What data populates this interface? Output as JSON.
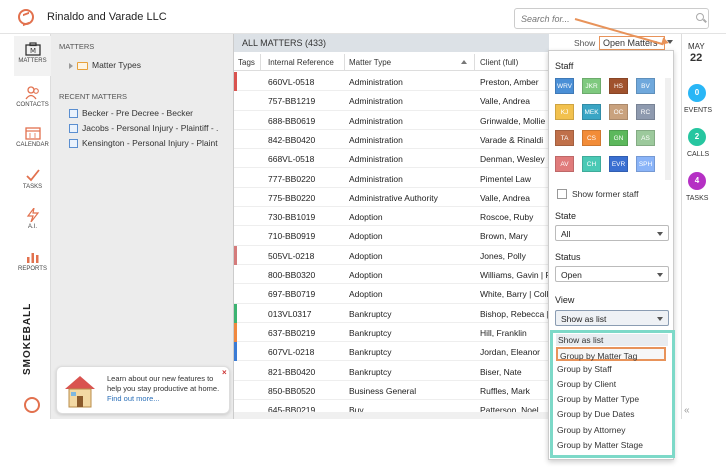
{
  "app": {
    "firm_name": "Rinaldo and Varade LLC",
    "brand": "SMOKEBALL"
  },
  "search": {
    "placeholder": "Search for..."
  },
  "nav": [
    {
      "label": "MATTERS"
    },
    {
      "label": "CONTACTS"
    },
    {
      "label": "CALENDAR"
    },
    {
      "label": "TASKS"
    },
    {
      "label": "A.I."
    },
    {
      "label": "REPORTS"
    }
  ],
  "sidepanel": {
    "heading": "MATTERS",
    "tree_item": "Matter Types",
    "recent_heading": "RECENT MATTERS",
    "recent": [
      "Becker - Pre Decree - Becker",
      "Jacobs - Personal Injury - Plaintiff - .",
      "Kensington - Personal Injury - Plaint"
    ]
  },
  "promo": {
    "text": "Learn about our new features to help you stay productive at home.",
    "link": "Find out more...",
    "close": "×"
  },
  "main": {
    "title": "ALL MATTERS (433)",
    "show_label": "Show",
    "show_value": "Open Matters",
    "columns": [
      "Tags",
      "Internal Reference",
      "Matter Type",
      "Client (full)"
    ],
    "rows": [
      {
        "tag": "#d9534f",
        "ref": "660VL-0518",
        "type": "Administration",
        "client": "Preston, Amber"
      },
      {
        "tag": "",
        "ref": "757-BB1219",
        "type": "Administration",
        "client": "Valle, Andrea"
      },
      {
        "tag": "",
        "ref": "688-BB0619",
        "type": "Administration",
        "client": "Grinwalde, Mollie"
      },
      {
        "tag": "",
        "ref": "842-BB0420",
        "type": "Administration",
        "client": "Varade & Rinaldi"
      },
      {
        "tag": "",
        "ref": "668VL-0518",
        "type": "Administration",
        "client": "Denman, Wesley"
      },
      {
        "tag": "",
        "ref": "777-BB0220",
        "type": "Administration",
        "client": "Pimentel Law"
      },
      {
        "tag": "",
        "ref": "775-BB0220",
        "type": "Administrative Authority",
        "client": "Valle, Andrea"
      },
      {
        "tag": "",
        "ref": "730-BB1019",
        "type": "Adoption",
        "client": "Roscoe, Ruby"
      },
      {
        "tag": "",
        "ref": "710-BB0919",
        "type": "Adoption",
        "client": "Brown, Mary"
      },
      {
        "tag": "#d47b7b",
        "ref": "505VL-0218",
        "type": "Adoption",
        "client": "Jones, Polly"
      },
      {
        "tag": "",
        "ref": "800-BB0320",
        "type": "Adoption",
        "client": "Williams, Gavin | P"
      },
      {
        "tag": "",
        "ref": "697-BB0719",
        "type": "Adoption",
        "client": "White, Barry | Coll"
      },
      {
        "tag": "#3cb371",
        "ref": "013VL0317",
        "type": "Bankruptcy",
        "client": "Bishop, Rebecca |"
      },
      {
        "tag": "#f0883e",
        "ref": "637-BB0219",
        "type": "Bankruptcy",
        "client": "Hill, Franklin"
      },
      {
        "tag": "#3a7bd5",
        "ref": "607VL-0218",
        "type": "Bankruptcy",
        "client": "Jordan, Eleanor"
      },
      {
        "tag": "",
        "ref": "821-BB0420",
        "type": "Bankruptcy",
        "client": "Biser, Nate"
      },
      {
        "tag": "",
        "ref": "850-BB0520",
        "type": "Business General",
        "client": "Ruffles, Mark"
      },
      {
        "tag": "",
        "ref": "645-BB0219",
        "type": "Buy",
        "client": "Patterson, Noel"
      }
    ]
  },
  "filters": {
    "staff_label": "Staff",
    "staff": [
      {
        "code": "WRV",
        "color": "#4a8fd6"
      },
      {
        "code": "JKR",
        "color": "#7fc97f"
      },
      {
        "code": "HS",
        "color": "#a0522d"
      },
      {
        "code": "BV",
        "color": "#6fa8dc"
      },
      {
        "code": "KJ",
        "color": "#f2c14e"
      },
      {
        "code": "MEK",
        "color": "#3aa5c4"
      },
      {
        "code": "OC",
        "color": "#c9a27e"
      },
      {
        "code": "RC",
        "color": "#8e9aaf"
      },
      {
        "code": "TA",
        "color": "#c0704a"
      },
      {
        "code": "CS",
        "color": "#f28c38"
      },
      {
        "code": "GN",
        "color": "#5cb85c"
      },
      {
        "code": "AS",
        "color": "#9cc99c"
      },
      {
        "code": "AV",
        "color": "#e07b7b"
      },
      {
        "code": "CH",
        "color": "#4ac9b5"
      },
      {
        "code": "EVR",
        "color": "#3a6fd1"
      },
      {
        "code": "SPH",
        "color": "#8ab4f8"
      }
    ],
    "show_former": "Show former staff",
    "state_label": "State",
    "state_value": "All",
    "status_label": "Status",
    "status_value": "Open",
    "view_label": "View",
    "view_value": "Show as list",
    "view_options": [
      "Show as list",
      "Group by Matter Tag",
      "Group by Staff",
      "Group by Client",
      "Group by Matter Type",
      "Group by Due Dates",
      "Group by Attorney",
      "Group by Matter Stage"
    ]
  },
  "rail": {
    "month": "MAY",
    "day": "22",
    "events_count": "0",
    "events_label": "EVENTS",
    "calls_count": "2",
    "calls_label": "CALLS",
    "tasks_count": "4",
    "tasks_label": "TASKS",
    "collapse": "«"
  }
}
